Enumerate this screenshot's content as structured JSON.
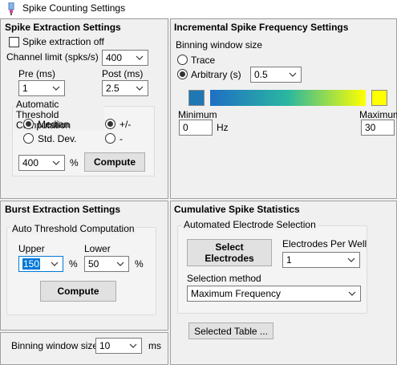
{
  "window": {
    "title": "Spike Counting Settings",
    "icon": "app-icon"
  },
  "spike_extraction": {
    "title": "Spike Extraction Settings",
    "extraction_off_label": "Spike extraction off",
    "extraction_off_checked": false,
    "channel_limit_label": "Channel limit (spks/s)",
    "channel_limit_value": "400",
    "pre_label": "Pre (ms)",
    "pre_value": "1",
    "post_label": "Post (ms)",
    "post_value": "2.5",
    "auto_threshold": {
      "title": "Automatic Threshold Computation",
      "median_label": "Median",
      "median_selected": true,
      "stddev_label": "Std. Dev.",
      "stddev_selected": false,
      "plusminus_label": "+/-",
      "plusminus_selected": true,
      "minus_label": "-",
      "minus_selected": false,
      "percent_value": "400",
      "percent_unit": "%",
      "compute_label": "Compute"
    }
  },
  "incremental": {
    "title": "Incremental Spike Frequency Settings",
    "binning_label": "Binning window size",
    "trace_label": "Trace",
    "trace_selected": false,
    "arbitrary_label": "Arbitrary (s)",
    "arbitrary_selected": true,
    "arbitrary_value": "0.5",
    "minimum_label": "Minimum",
    "minimum_value": "0",
    "minimum_unit": "Hz",
    "maximum_label": "Maximum",
    "maximum_value": "30",
    "colors": {
      "min_swatch": "#1f77b4",
      "max_swatch": "#ffff00",
      "gradient_start": "#1f6fc4",
      "gradient_mid": "#2ab7a0",
      "gradient_end": "#ffff00"
    }
  },
  "burst": {
    "title": "Burst Extraction Settings",
    "auto_title": "Auto Threshold Computation",
    "upper_label": "Upper",
    "upper_value": "150",
    "upper_unit": "%",
    "lower_label": "Lower",
    "lower_value": "50",
    "lower_unit": "%",
    "compute_label": "Compute"
  },
  "binning": {
    "label": "Binning window size",
    "value": "10",
    "unit": "ms"
  },
  "cumulative": {
    "title": "Cumulative Spike Statistics",
    "auto_title": "Automated Electrode Selection",
    "select_button": "Select Electrodes",
    "per_well_label": "Electrodes Per Well",
    "per_well_value": "1",
    "method_label": "Selection method",
    "method_value": "Maximum Frequency",
    "selected_table_button": "Selected Table ..."
  }
}
